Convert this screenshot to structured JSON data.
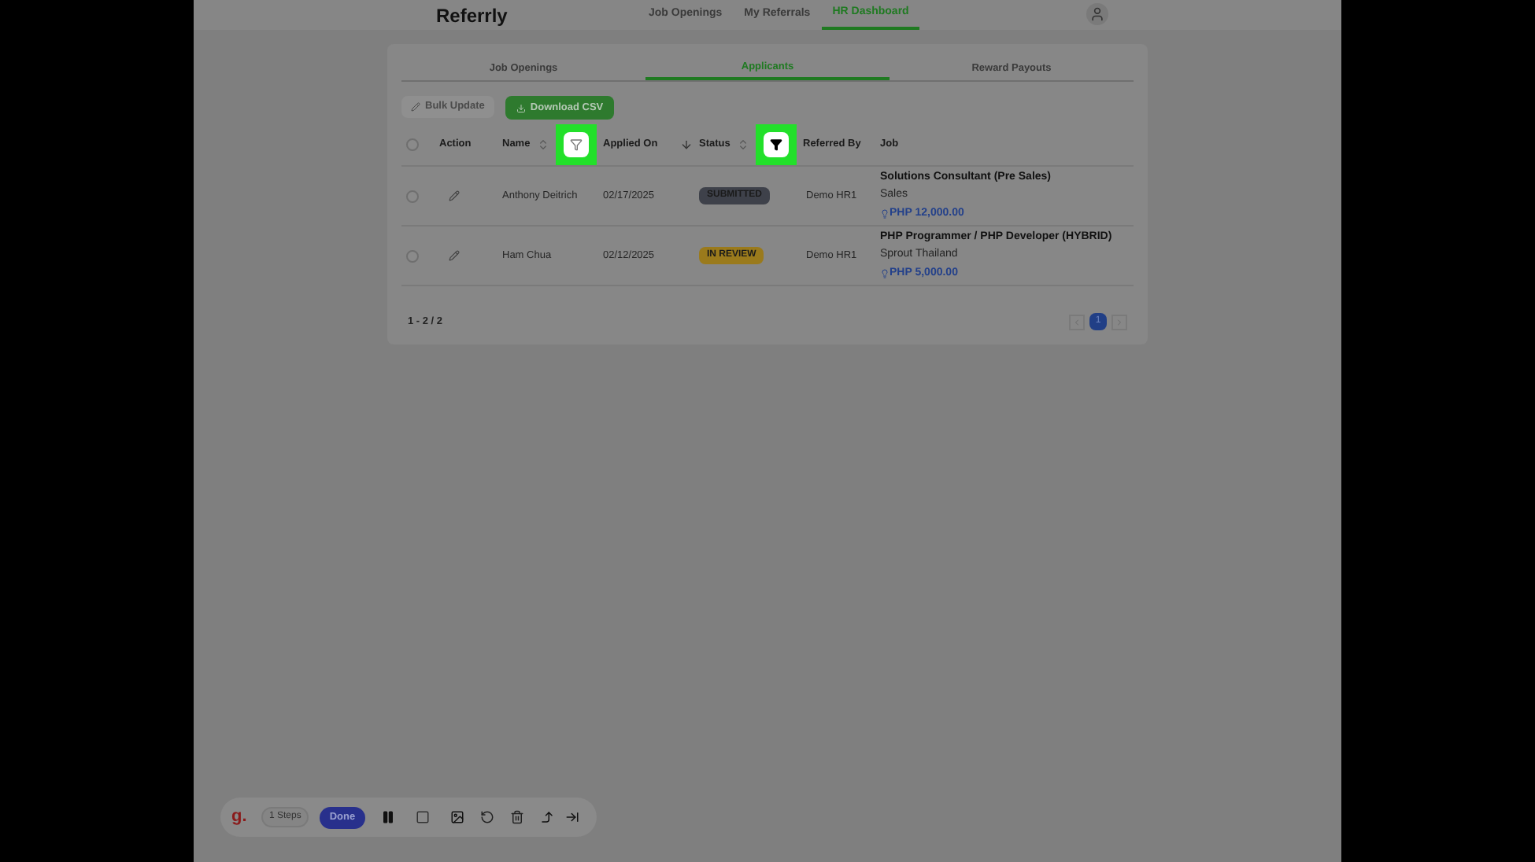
{
  "brand": "Referrly",
  "nav": [
    {
      "label": "Job Openings",
      "selected": false
    },
    {
      "label": "My Referrals",
      "selected": false
    },
    {
      "label": "HR Dashboard",
      "selected": true
    }
  ],
  "tabs": [
    {
      "label": "Job Openings",
      "selected": false
    },
    {
      "label": "Applicants",
      "selected": true
    },
    {
      "label": "Reward Payouts",
      "selected": false
    }
  ],
  "actions": {
    "bulk_update": "Bulk Update",
    "download": "Download CSV"
  },
  "select_all": {
    "checked": false
  },
  "columns": [
    {
      "label": "Action",
      "kind": "plain"
    },
    {
      "label": "Name",
      "kind": "filter"
    },
    {
      "label": "Applied On",
      "kind": "sort"
    },
    {
      "label": "Status",
      "kind": "filter_active"
    },
    {
      "label": "Referred By",
      "kind": "plain"
    },
    {
      "label": "Job",
      "kind": "plain"
    }
  ],
  "rows": [
    {
      "checked": false,
      "name": "Anthony Deitrich",
      "applied_on": "02/17/2025",
      "status": "SUBMITTED",
      "color": "#3e414a",
      "referred_by": "Demo HR1",
      "job_title": "Solutions Consultant (Pre Sales)",
      "company": "Sales",
      "reward": "PHP 12,000.00"
    },
    {
      "checked": false,
      "name": "Ham Chua",
      "applied_on": "02/12/2025",
      "status": "IN REVIEW",
      "color": "#9a7a1c",
      "referred_by": "Demo HR1",
      "job_title": "PHP Programmer / PHP Developer (HYBRID)",
      "company": "Sprout Thailand",
      "reward": "PHP 5,000.00"
    }
  ],
  "pagination": {
    "summary": "1 - 2 / 2",
    "pages": [
      {
        "label": "1",
        "selected": true
      }
    ]
  },
  "recorder": {
    "logo": "g.",
    "steps": "1 Steps",
    "done": "Done"
  }
}
